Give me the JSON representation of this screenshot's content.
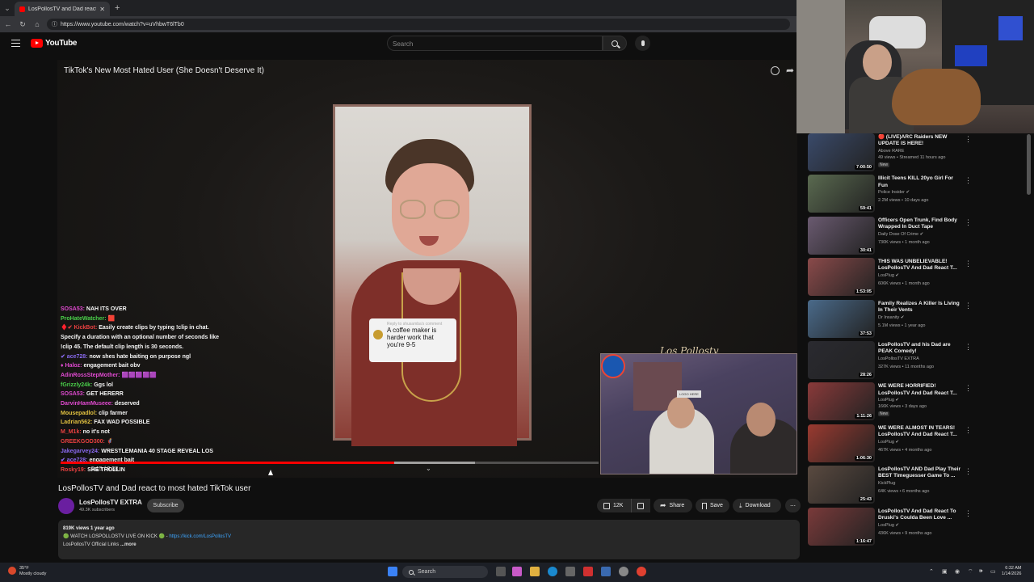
{
  "browser": {
    "tab_title": "LosPollosTV and Dad react to",
    "new_tab": "+",
    "url": "https://www.youtube.com/watch?v=uVhbwT6lTb0"
  },
  "header": {
    "logo": "YouTube",
    "search_placeholder": "Search"
  },
  "player": {
    "title": "TikTok's New Most Hated User (She Doesn't Deserve It)",
    "caption_small": "Reply to shusamba's comment",
    "caption": "A coffee maker is harder work that you're 9-5",
    "time": "5:15 / 8:38",
    "progress": 0.62,
    "buffered": 0.77,
    "cam_sign": "LOGO HERE",
    "signature": "Los Pollostv"
  },
  "chat": [
    {
      "user": "SOSA53:",
      "msg": "NAH ITS OVER",
      "color": "#e04ad0"
    },
    {
      "user": "ProHateWatcher:",
      "msg": "🟥",
      "color": "#4ad04a"
    },
    {
      "user": "♦️✔ KickBot:",
      "msg": "Easily create clips by typing !clip in chat.",
      "color": "#e84040"
    },
    {
      "user": "",
      "msg": "Specify a duration with an optional number of seconds like",
      "color": "#fff"
    },
    {
      "user": "",
      "msg": "!clip 45. The default clip length is 30 seconds.",
      "color": "#fff"
    },
    {
      "user": "✔ ace728:",
      "msg": "now shes hate baiting on purpose ngl",
      "color": "#8a6af0"
    },
    {
      "user": "♦ Haloz:",
      "msg": "engagement bait obv",
      "color": "#e04ad0"
    },
    {
      "user": "AdinRossStepMother:",
      "msg": "🟪🟪🟪🟪🟪",
      "color": "#e04ad0"
    },
    {
      "user": "fGrizzly24k:",
      "msg": "Ggs lol",
      "color": "#4ad04a"
    },
    {
      "user": "SOSA53:",
      "msg": "GET HERERR",
      "color": "#e04ad0"
    },
    {
      "user": "DarvinHamMuseee:",
      "msg": "deserved",
      "color": "#e04ad0"
    },
    {
      "user": "Mousepadlol:",
      "msg": "clip farmer",
      "color": "#e0c040"
    },
    {
      "user": "Ladrian562:",
      "msg": "FAX WAD POSSIBLE",
      "color": "#e0c040"
    },
    {
      "user": "M_M1k:",
      "msg": "no it's not",
      "color": "#e84040"
    },
    {
      "user": "GREEKGOD300:",
      "msg": "🦸",
      "color": "#e84040"
    },
    {
      "user": "Jakegarvey24:",
      "msg": "WRESTLEMANIA 40 STAGE REVEAL LOS",
      "color": "#8a6af0"
    },
    {
      "user": "✔ ace728:",
      "msg": "engagement bait",
      "color": "#8a6af0"
    },
    {
      "user": "Rosky19:",
      "msg": "SHE TROLLIN",
      "color": "#e84040"
    }
  ],
  "video": {
    "title": "LosPollosTV and Dad react to most hated TikTok user",
    "channel": "LosPollosTV EXTRA",
    "subscribers": "49.3K subscribers",
    "subscribe": "Subscribe",
    "likes": "12K",
    "share": "Share",
    "save": "Save",
    "download": "Download",
    "more_menu": "⋯",
    "description": {
      "meta": "819K views  1 year ago",
      "line1_prefix": "🟢 WATCH LOSPOLLOSTV LIVE ON KICK 🟢 - ",
      "line1_link": "https://kick.com/LosPollosTV",
      "line2": "LosPollosTV Official Links",
      "more": "...more"
    }
  },
  "recommendations": [
    {
      "title": "🔴 (LIVE)ARC Raiders NEW UPDATE IS HERE!",
      "channel": "Above RARE",
      "meta": "49 views • Streamed 11 hours ago",
      "duration": "7:00:50",
      "badge": "New",
      "thumb": "#3a4a6a"
    },
    {
      "title": "Illicit Teens KILL 20yo Girl For Fun",
      "channel": "Police Insider ✔",
      "meta": "2.2M views • 10 days ago",
      "duration": "59:41",
      "badge": "",
      "thumb": "#5a6a50"
    },
    {
      "title": "Officers Open Trunk, Find Body Wrapped In Duct Tape",
      "channel": "Daily Dose Of Crime ✔",
      "meta": "730K views • 1 month ago",
      "duration": "30:41",
      "badge": "",
      "thumb": "#6a5a70"
    },
    {
      "title": "THIS WAS UNBELIEVABLE! LosPollosTV And Dad React T...",
      "channel": "LosPlug ✔",
      "meta": "606K views • 1 month ago",
      "duration": "1:53:05",
      "badge": "",
      "thumb": "#8a4a4a"
    },
    {
      "title": "Family Realizes A Killer Is Living In Their Vents",
      "channel": "Dr Insanity ✔",
      "meta": "5.1M views • 1 year ago",
      "duration": "37:53",
      "badge": "",
      "thumb": "#4a6a8a"
    },
    {
      "title": "LosPollosTV and his Dad are PEAK Comedy!",
      "channel": "LosPollosTV EXTRA",
      "meta": "327K views • 11 months ago",
      "duration": "28:26",
      "badge": "",
      "thumb": "#2a2a30"
    },
    {
      "title": "WE WERE HORRIFIED! LosPollosTV And Dad React T...",
      "channel": "LosPlug ✔",
      "meta": "166K views • 3 days ago",
      "duration": "1:11:26",
      "badge": "New",
      "thumb": "#8a3a3a"
    },
    {
      "title": "WE WERE ALMOST IN TEARS! LosPollosTV And Dad React T...",
      "channel": "LosPlug ✔",
      "meta": "467K views • 4 months ago",
      "duration": "1:06:30",
      "badge": "",
      "thumb": "#9a3a30"
    },
    {
      "title": "LosPollosTV AND Dad Play Their BEST Timeguesser Game To ...",
      "channel": "KickPlug",
      "meta": "64K views • 6 months ago",
      "duration": "25:43",
      "badge": "",
      "thumb": "#5a4a40"
    },
    {
      "title": "LosPollosTV And Dad React To Druski's Coulda Been Love ...",
      "channel": "LosPlug ✔",
      "meta": "436K views • 9 months ago",
      "duration": "1:16:47",
      "badge": "",
      "thumb": "#7a3a3a"
    }
  ],
  "taskbar": {
    "temp": "35°F",
    "weather": "Mostly cloudy",
    "search": "Search",
    "time": "6:32 AM",
    "date": "1/14/2026"
  }
}
